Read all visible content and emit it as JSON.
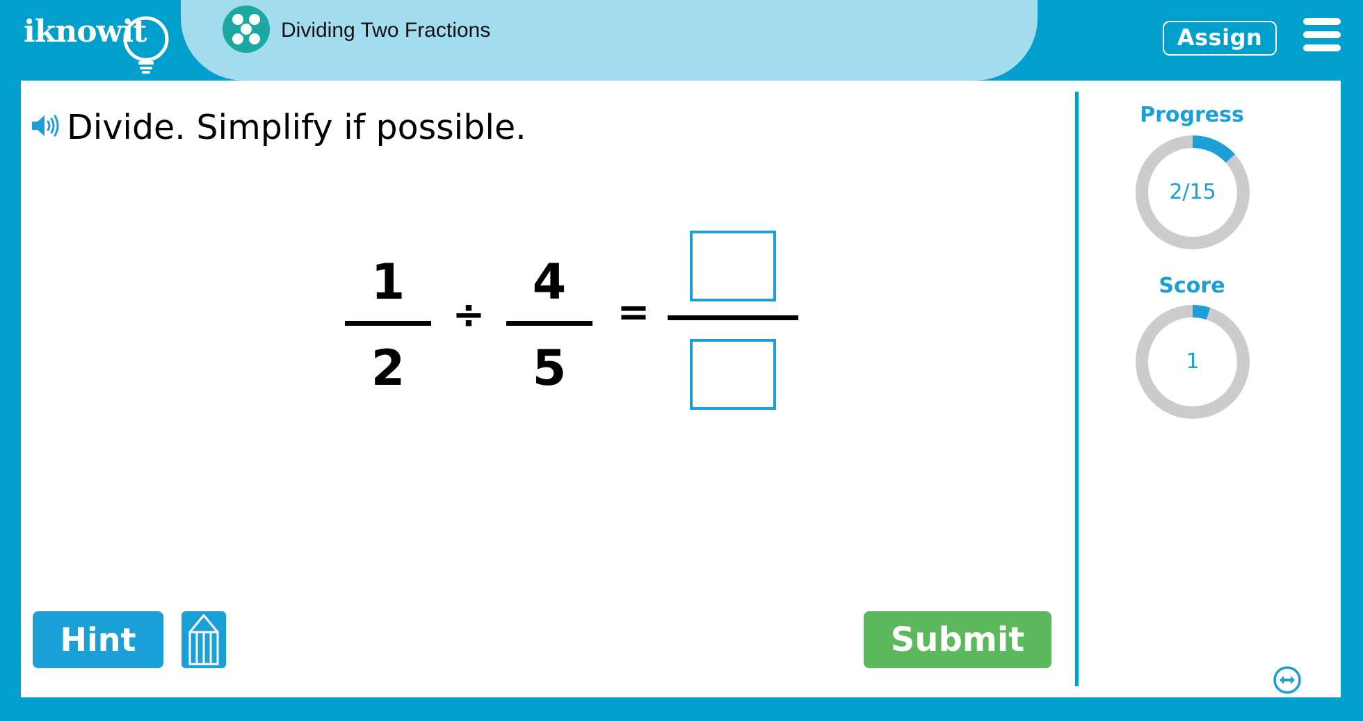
{
  "brand": {
    "logo_text": "iknowit",
    "accent_color": "#009fcc",
    "panel_color": "#a3dcee",
    "submit_color": "#5cb85c"
  },
  "header": {
    "lesson_title": "Dividing Two Fractions",
    "lesson_icon": "dots-circle-icon",
    "assign_label": "Assign",
    "menu_icon": "hamburger-menu-icon"
  },
  "question": {
    "speaker_icon": "speaker-icon",
    "instruction": "Divide. Simplify if possible.",
    "fraction1": {
      "numerator": "1",
      "denominator": "2"
    },
    "operator": "÷",
    "fraction2": {
      "numerator": "4",
      "denominator": "5"
    },
    "equals": "=",
    "answer": {
      "numerator": "",
      "denominator": ""
    }
  },
  "actions": {
    "hint_label": "Hint",
    "pencil_icon": "pencil-icon",
    "submit_label": "Submit"
  },
  "sidebar": {
    "progress_label": "Progress",
    "progress_text": "2/15",
    "progress_fraction": 0.1333,
    "score_label": "Score",
    "score_text": "1",
    "score_fraction": 0.05,
    "expand_icon": "expand-arrows-icon"
  }
}
